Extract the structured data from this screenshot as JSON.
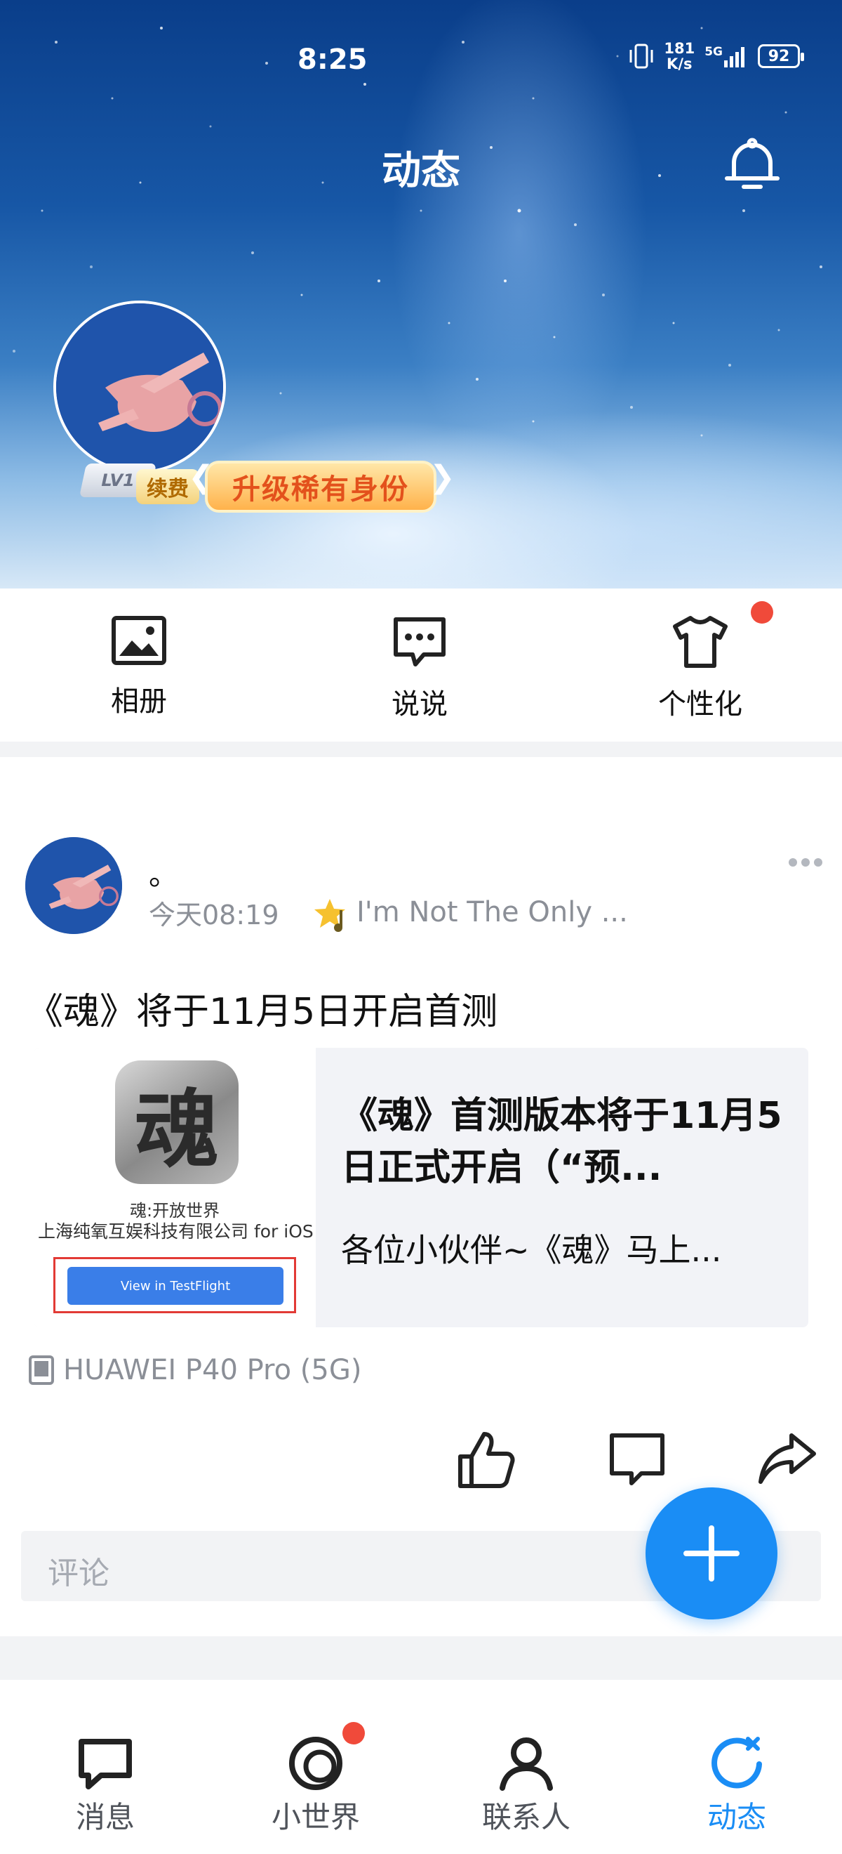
{
  "status_bar": {
    "time": "8:25",
    "net_speed_value": "181",
    "net_speed_unit": "K/s",
    "signal": "5G",
    "battery": "92"
  },
  "header": {
    "title": "动态"
  },
  "profile": {
    "level": "LV1",
    "renew_label": "续费",
    "upgrade_label": "升级稀有身份"
  },
  "quick_actions": [
    {
      "label": "相册",
      "icon": "image-icon"
    },
    {
      "label": "说说",
      "icon": "chat-bubble-icon"
    },
    {
      "label": "个性化",
      "icon": "tshirt-icon",
      "badge": true
    }
  ],
  "post": {
    "author": "。",
    "time": "今天08:19",
    "song": "I'm Not The Only ...",
    "text": "《魂》将于11月5日开启首测",
    "card": {
      "thumb_app_name": "魂:开放世界",
      "thumb_company": "上海纯氧互娱科技有限公司 for iOS",
      "thumb_button": "View in TestFlight",
      "title": "《魂》首测版本将于11月5日正式开启（“预...",
      "description": "各位小伙伴~《魂》马上..."
    },
    "device": "HUAWEI P40 Pro (5G)",
    "comment_placeholder": "评论"
  },
  "bottom_nav": [
    {
      "label": "消息",
      "icon": "message-icon",
      "active": false
    },
    {
      "label": "小世界",
      "icon": "world-icon",
      "active": false,
      "badge": true
    },
    {
      "label": "联系人",
      "icon": "contacts-icon",
      "active": false
    },
    {
      "label": "动态",
      "icon": "feed-refresh-icon",
      "active": true
    }
  ],
  "colors": {
    "accent": "#1a8df5",
    "badge": "#f04a3a",
    "muted": "#8b8f97"
  }
}
